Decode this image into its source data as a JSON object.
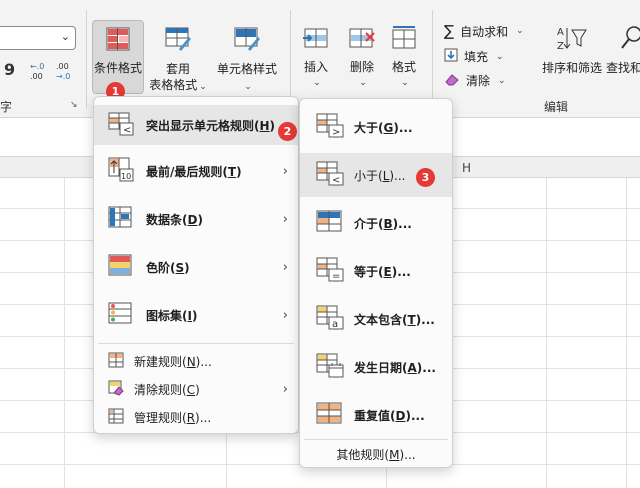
{
  "ribbon": {
    "conditional_format": "条件格式",
    "table_format_line1": "套用",
    "table_format_line2": "表格格式",
    "cell_style": "单元格样式",
    "insert": "插入",
    "delete": "删除",
    "format": "格式",
    "autosum": "自动求和",
    "fill": "填充",
    "clear": "清除",
    "sort_filter": "排序和筛选",
    "find_select": "查找和",
    "group_edit": "编辑",
    "group_num": "字",
    "num_comma": "9",
    "num_inc": ".0\n.00",
    "num_dec": ".00\n→.0"
  },
  "grid": {
    "col_h": "H"
  },
  "menu_main": {
    "items": [
      {
        "label": "突出显示单元格规则(H)",
        "key": "H",
        "pre": "突出显示单元格规则(",
        "post": ")"
      },
      {
        "label": "最前/最后规则(T)",
        "key": "T",
        "pre": "最前/最后规则(",
        "post": ")"
      },
      {
        "label": "数据条(D)",
        "key": "D",
        "pre": "数据条(",
        "post": ")"
      },
      {
        "label": "色阶(S)",
        "key": "S",
        "pre": "色阶(",
        "post": ")"
      },
      {
        "label": "图标集(I)",
        "key": "I",
        "pre": "图标集(",
        "post": ")"
      }
    ],
    "new_rule": {
      "pre": "新建规则(",
      "key": "N",
      "post": ")..."
    },
    "clear_rule": {
      "pre": "清除规则(",
      "key": "C",
      "post": ")"
    },
    "manage_rule": {
      "pre": "管理规则(",
      "key": "R",
      "post": ")..."
    }
  },
  "menu_sub": {
    "items": [
      {
        "pre": "大于(",
        "key": "G",
        "post": ")..."
      },
      {
        "pre": "小于(",
        "key": "L",
        "post": ")..."
      },
      {
        "pre": "介于(",
        "key": "B",
        "post": ")..."
      },
      {
        "pre": "等于(",
        "key": "E",
        "post": ")..."
      },
      {
        "pre": "文本包含(",
        "key": "T",
        "post": ")..."
      },
      {
        "pre": "发生日期(",
        "key": "A",
        "post": ")..."
      },
      {
        "pre": "重复值(",
        "key": "D",
        "post": ")..."
      }
    ],
    "other": {
      "pre": "其他规则(",
      "key": "M",
      "post": ")..."
    }
  },
  "badges": [
    "1",
    "2",
    "3"
  ],
  "colors": {
    "badge": "#e53935",
    "accent": "#2e75b6",
    "highlight": "#e6e6e6"
  }
}
